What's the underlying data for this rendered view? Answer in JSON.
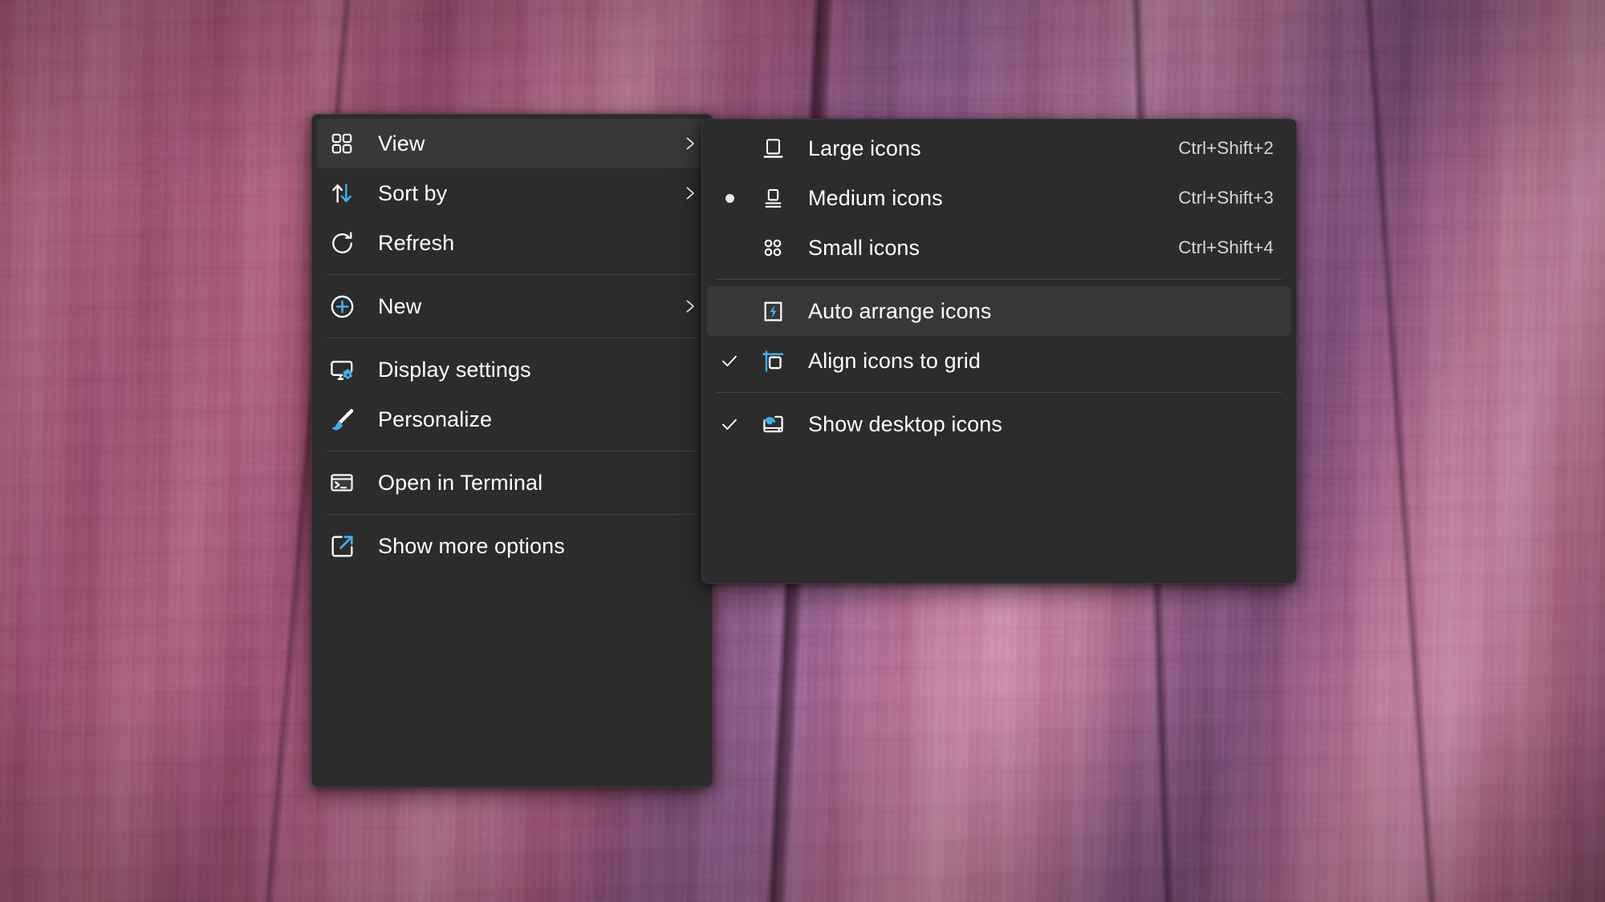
{
  "desktop": {
    "wallpaper_name": "abstract-pink-purple-paint-texture",
    "accent_color": "#41b0f0",
    "menu_background": "#2c2c2c",
    "menu_hover_background": "#383838",
    "menu_text_color": "#ffffff",
    "accel_text_color": "#d6d6d6"
  },
  "main_menu": {
    "name": "desktop-context-menu",
    "items": [
      {
        "id": "view",
        "label": "View",
        "icon": "grid-icon",
        "submenu": true,
        "accel": "",
        "highlighted": true,
        "separator_after": false
      },
      {
        "id": "sort-by",
        "label": "Sort by",
        "icon": "sort-arrows-icon",
        "submenu": true,
        "accel": "",
        "highlighted": false,
        "separator_after": false
      },
      {
        "id": "refresh",
        "label": "Refresh",
        "icon": "refresh-icon",
        "submenu": false,
        "accel": "",
        "highlighted": false,
        "separator_after": true
      },
      {
        "id": "new",
        "label": "New",
        "icon": "plus-circle-icon",
        "submenu": true,
        "accel": "",
        "highlighted": false,
        "separator_after": true
      },
      {
        "id": "display-settings",
        "label": "Display settings",
        "icon": "monitor-gear-icon",
        "submenu": false,
        "accel": "",
        "highlighted": false,
        "separator_after": false
      },
      {
        "id": "personalize",
        "label": "Personalize",
        "icon": "paintbrush-icon",
        "submenu": false,
        "accel": "",
        "highlighted": false,
        "separator_after": true
      },
      {
        "id": "open-in-terminal",
        "label": "Open in Terminal",
        "icon": "terminal-icon",
        "submenu": false,
        "accel": "",
        "highlighted": false,
        "separator_after": true
      },
      {
        "id": "show-more-options",
        "label": "Show more options",
        "icon": "open-external-icon",
        "submenu": false,
        "accel": "",
        "highlighted": false,
        "separator_after": false
      }
    ]
  },
  "view_submenu": {
    "name": "view-submenu",
    "items": [
      {
        "id": "large-icons",
        "label": "Large icons",
        "icon": "large-icons-icon",
        "accel": "Ctrl+Shift+2",
        "checked": false,
        "radio": false,
        "highlighted": false,
        "separator_after": false
      },
      {
        "id": "medium-icons",
        "label": "Medium icons",
        "icon": "medium-icons-icon",
        "accel": "Ctrl+Shift+3",
        "checked": false,
        "radio": true,
        "highlighted": false,
        "separator_after": false
      },
      {
        "id": "small-icons",
        "label": "Small icons",
        "icon": "small-icons-icon",
        "accel": "Ctrl+Shift+4",
        "checked": false,
        "radio": false,
        "highlighted": false,
        "separator_after": true
      },
      {
        "id": "auto-arrange-icons",
        "label": "Auto arrange icons",
        "icon": "auto-arrange-icon",
        "accel": "",
        "checked": false,
        "radio": false,
        "highlighted": true,
        "separator_after": false
      },
      {
        "id": "align-icons-to-grid",
        "label": "Align icons to grid",
        "icon": "align-grid-icon",
        "accel": "",
        "checked": true,
        "radio": false,
        "highlighted": false,
        "separator_after": true
      },
      {
        "id": "show-desktop-icons",
        "label": "Show desktop icons",
        "icon": "show-desktop-icon",
        "accel": "",
        "checked": true,
        "radio": false,
        "highlighted": false,
        "separator_after": false
      }
    ]
  }
}
